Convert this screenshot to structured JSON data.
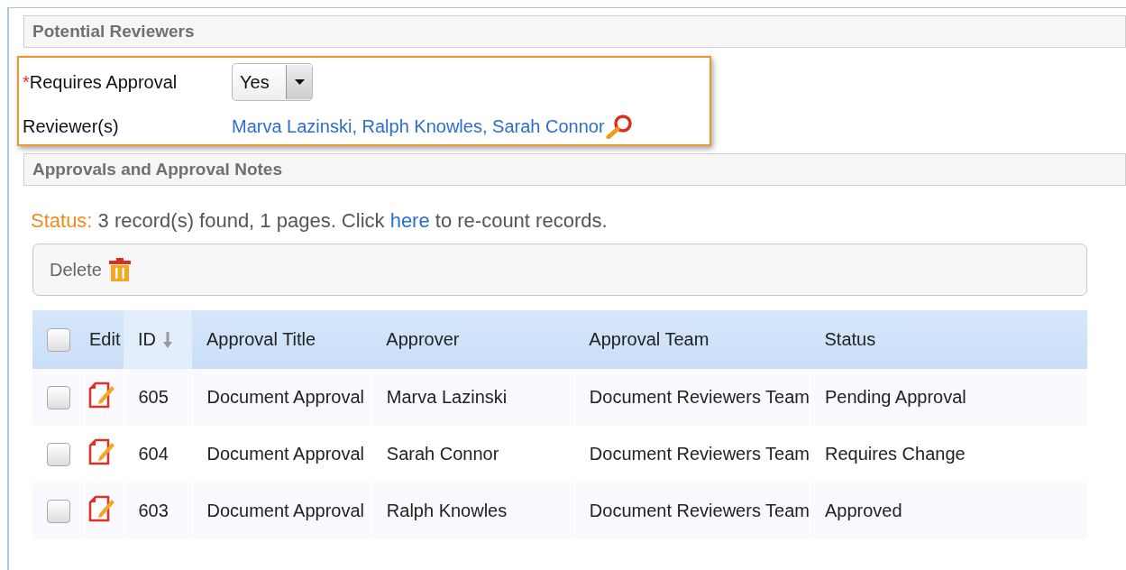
{
  "sections": [
    {
      "title": "Potential Reviewers"
    },
    {
      "title": "Approvals and Approval Notes"
    }
  ],
  "form": {
    "requires_approval": {
      "required_mark": "*",
      "label": "Requires Approval",
      "value": "Yes"
    },
    "reviewers": {
      "label": "Reviewer(s)",
      "names": [
        "Marva Lazinski",
        "Ralph Knowles",
        "Sarah Connor"
      ],
      "separator": ", "
    }
  },
  "status": {
    "label": "Status:",
    "text": "3 record(s) found, 1 pages. Click",
    "link": "here",
    "after": "to re-count records."
  },
  "toolbar": {
    "buttons": [
      {
        "label": "Delete"
      }
    ]
  },
  "table": {
    "select_all": {
      "checked": false
    },
    "edit_column": {
      "label": "Edit"
    },
    "columns": [
      {
        "label": "ID",
        "sorted": true
      },
      {
        "label": "Approval Title",
        "sorted": false
      },
      {
        "label": "Approver",
        "sorted": false
      },
      {
        "label": "Approval Team",
        "sorted": false
      },
      {
        "label": "Status",
        "sorted": false
      }
    ],
    "rows": [
      {
        "checked": false,
        "cells": [
          "605",
          "Document Approval",
          "Marva Lazinski",
          "Document Reviewers Team",
          "Pending Approval"
        ]
      },
      {
        "checked": false,
        "cells": [
          "604",
          "Document Approval",
          "Sarah Connor",
          "Document Reviewers Team",
          "Requires Change"
        ]
      },
      {
        "checked": false,
        "cells": [
          "603",
          "Document Approval",
          "Ralph Knowles",
          "Document Reviewers Team",
          "Approved"
        ]
      }
    ]
  }
}
